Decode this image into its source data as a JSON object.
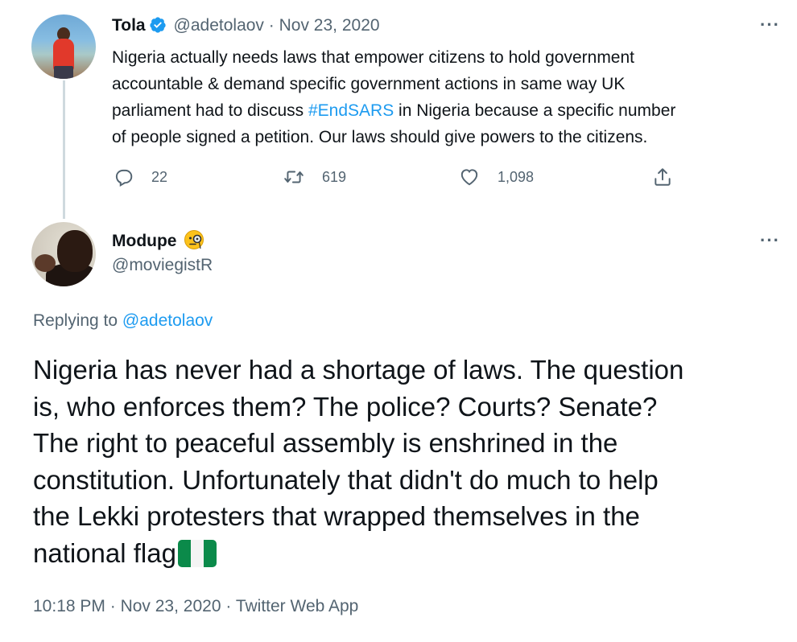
{
  "parent_tweet": {
    "author_name": "Tola",
    "author_handle": "@adetolaov",
    "separator": "·",
    "date": "Nov 23, 2020",
    "more_icon": "more-horizontal-icon",
    "text_before_hashtag_line1": "Nigeria actually needs laws that empower citizens to hold government",
    "text_before_hashtag_line2": "accountable & demand specific government actions in same way UK",
    "text_before_hashtag_line3": "parliament had to discuss ",
    "hashtag": "#EndSARS",
    "text_after_hashtag_line3": " in Nigeria because a specific number",
    "text_line4": "of people signed a petition. Our laws should give powers to the citizens.",
    "replies": "22",
    "retweets": "619",
    "likes": "1,098",
    "colors": {
      "hashtag": "#1d9bf0",
      "verified": "#1d9bf0"
    }
  },
  "reply_tweet": {
    "author_name": "Modupe",
    "author_emoji": "face-with-monocle",
    "author_handle": "@moviegistR",
    "replying_to_label": "Replying to",
    "replying_to_handle": "@adetolaov",
    "line1": "Nigeria has never had a shortage of laws. The question",
    "line2": "is, who enforces them? The police? Courts? Senate?",
    "line3": "The right to peaceful assembly is enshrined in the",
    "line4": "constitution. Unfortunately that didn't do much to help",
    "line5": "the Lekki protesters that wrapped themselves in the",
    "line6": "national flag",
    "flag_emoji": "nigeria-flag",
    "time": "10:18 PM",
    "date": "Nov 23, 2020",
    "source": "Twitter Web App",
    "separator": "·"
  }
}
